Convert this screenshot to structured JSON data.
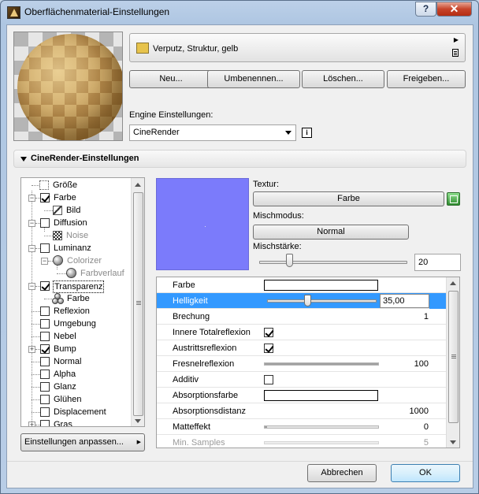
{
  "window": {
    "title": "Oberflächenmaterial-Einstellungen",
    "help_label": "?",
    "close_label": "✕"
  },
  "material": {
    "name": "Verputz, Struktur, gelb",
    "swatch_color": "#e7c34c"
  },
  "actions": {
    "new_label": "Neu...",
    "rename_label": "Umbenennen...",
    "delete_label": "Löschen...",
    "share_label": "Freigeben..."
  },
  "engine": {
    "label": "Engine Einstellungen:",
    "selected": "CineRender",
    "info_label": "i"
  },
  "section": {
    "title": "CineRender-Einstellungen"
  },
  "tree": {
    "items": [
      {
        "label": "Größe"
      },
      {
        "label": "Farbe"
      },
      {
        "label": "Bild"
      },
      {
        "label": "Diffusion"
      },
      {
        "label": "Noise"
      },
      {
        "label": "Luminanz"
      },
      {
        "label": "Colorizer"
      },
      {
        "label": "Farbverlauf"
      },
      {
        "label": "Transparenz"
      },
      {
        "label": "Farbe"
      },
      {
        "label": "Reflexion"
      },
      {
        "label": "Umgebung"
      },
      {
        "label": "Nebel"
      },
      {
        "label": "Bump"
      },
      {
        "label": "Normal"
      },
      {
        "label": "Alpha"
      },
      {
        "label": "Glanz"
      },
      {
        "label": "Glühen"
      },
      {
        "label": "Displacement"
      },
      {
        "label": "Gras"
      }
    ],
    "customize_label": "Einstellungen anpassen..."
  },
  "channel": {
    "preview_color": "#7b7bfb",
    "texture_label": "Textur:",
    "texture_button": "Farbe",
    "blend_mode_label": "Mischmodus:",
    "blend_mode_value": "Normal",
    "blend_strength_label": "Mischstärke:",
    "blend_strength_value": "20",
    "blend_strength_fraction": 0.2
  },
  "properties": {
    "rows": [
      {
        "name": "Farbe"
      },
      {
        "name": "Helligkeit",
        "value": "35,00"
      },
      {
        "name": "Brechung",
        "value": "1"
      },
      {
        "name": "Innere Totalreflexion"
      },
      {
        "name": "Austrittsreflexion"
      },
      {
        "name": "Fresnelreflexion",
        "value": "100"
      },
      {
        "name": "Additiv"
      },
      {
        "name": "Absorptionsfarbe"
      },
      {
        "name": "Absorptionsdistanz",
        "value": "1000"
      },
      {
        "name": "Matteffekt",
        "value": "0"
      },
      {
        "name": "Min. Samples",
        "value": "5"
      }
    ]
  },
  "footer": {
    "cancel_label": "Abbrechen",
    "ok_label": "OK"
  }
}
